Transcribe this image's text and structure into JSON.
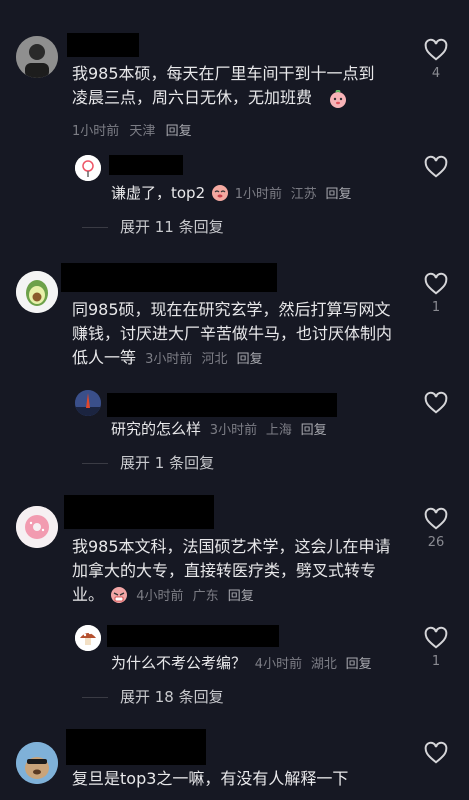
{
  "comments": [
    {
      "text": "我985本硕，每天在厂里车间干到十一点到凌晨三点，周六日无休，无加班费",
      "time": "1小时前",
      "location": "天津",
      "reply": "回复",
      "likes": "4",
      "sub": {
        "text": "谦虚了，top2",
        "time": "1小时前",
        "location": "江苏",
        "reply": "回复",
        "likes": ""
      },
      "expand": "展开 11 条回复"
    },
    {
      "text": "同985硕，现在在研究玄学，然后打算写网文赚钱，讨厌进大厂辛苦做牛马，也讨厌体制内低人一等",
      "time": "3小时前",
      "location": "河北",
      "reply": "回复",
      "likes": "1",
      "sub": {
        "text": "研究的怎么样",
        "time": "3小时前",
        "location": "上海",
        "reply": "回复",
        "likes": ""
      },
      "expand": "展开 1 条回复"
    },
    {
      "text": "我985本文科，法国硕艺术学，这会儿在申请加拿大的大专，直接转医疗类，劈叉式转专业。",
      "time": "4小时前",
      "location": "广东",
      "reply": "回复",
      "likes": "26",
      "sub": {
        "text": "为什么不考公考编？",
        "time": "4小时前",
        "location": "湖北",
        "reply": "回复",
        "likes": "1"
      },
      "expand": "展开 18 条回复"
    },
    {
      "text": "复旦是top3之一嘛，有没有人解释一下",
      "likes": ""
    }
  ],
  "colors": {
    "background": "#161823",
    "meta": "#7c7d85",
    "name_redaction": "#000000"
  }
}
